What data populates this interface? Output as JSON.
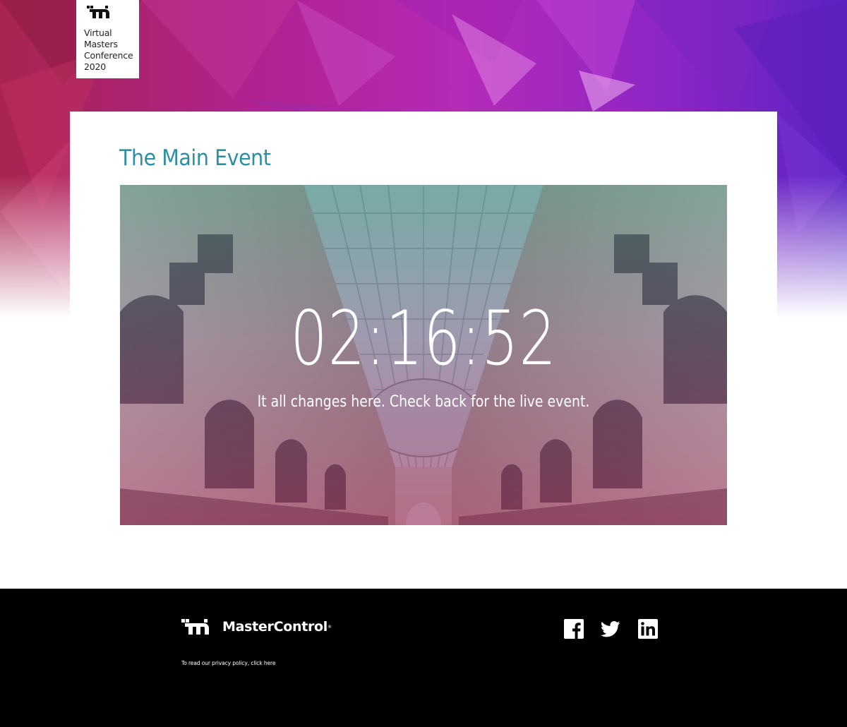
{
  "brand": {
    "conference_lines": [
      "Virtual",
      "Masters",
      "Conference",
      "2020"
    ],
    "company_name": "MasterControl",
    "trademark": "®"
  },
  "main": {
    "title": "The Main Event",
    "countdown": "02:16:52",
    "message": "It all changes here. Check back for the live event."
  },
  "footer": {
    "privacy_text": "To read our privacy policy, click here",
    "social": [
      "facebook-icon",
      "twitter-icon",
      "linkedin-icon"
    ]
  },
  "colors": {
    "title_teal": "#2e8fa3",
    "hero_magenta": "#b52ab0",
    "hero_purple": "#6a22c8",
    "footer_black": "#000000"
  }
}
